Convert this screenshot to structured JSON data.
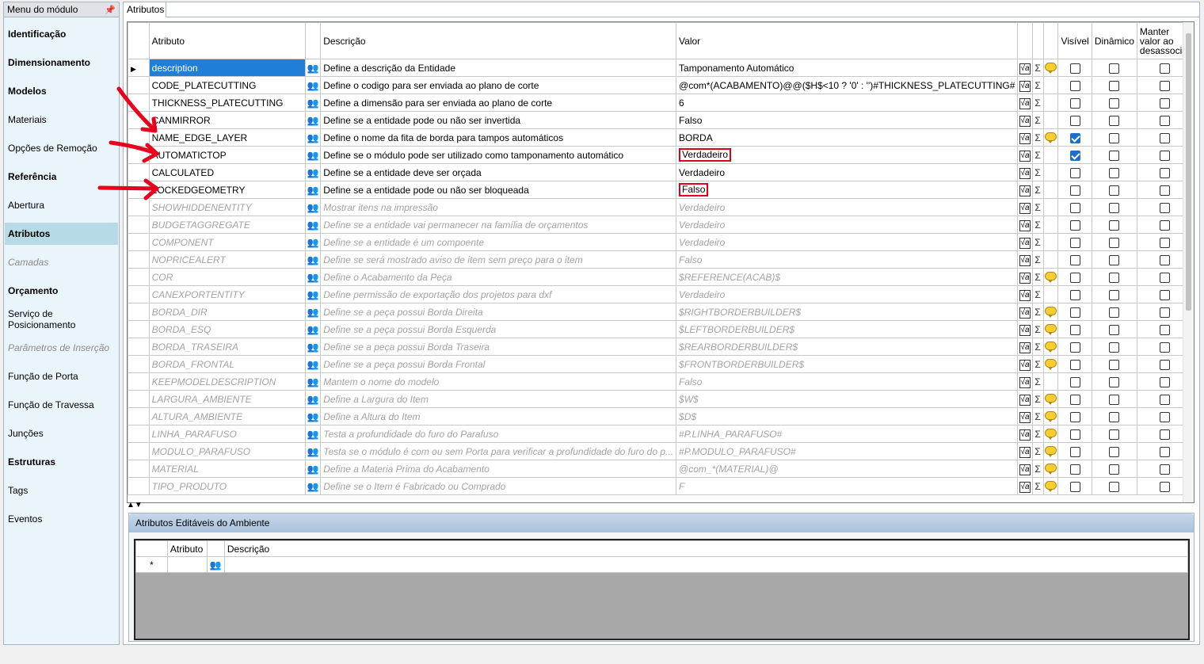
{
  "sidebar": {
    "title": "Menu do módulo",
    "items": [
      {
        "label": "Identificação",
        "style": "bold"
      },
      {
        "label": "Dimensionamento",
        "style": "bold"
      },
      {
        "label": "Modelos",
        "style": "bold"
      },
      {
        "label": "Materiais",
        "style": "normal"
      },
      {
        "label": "Opções de Remoção",
        "style": "normal"
      },
      {
        "label": "Referência",
        "style": "bold"
      },
      {
        "label": "Abertura",
        "style": "normal"
      },
      {
        "label": "Atributos",
        "style": "active"
      },
      {
        "label": "Camadas",
        "style": "disabled"
      },
      {
        "label": "Orçamento",
        "style": "bold"
      },
      {
        "label": "Serviço de Posicionamento",
        "style": "normal"
      },
      {
        "label": "Parâmetros de Inserção",
        "style": "disabled"
      },
      {
        "label": "Função de Porta",
        "style": "normal"
      },
      {
        "label": "Função de Travessa",
        "style": "normal"
      },
      {
        "label": "Junções",
        "style": "normal"
      },
      {
        "label": "Estruturas",
        "style": "bold"
      },
      {
        "label": "Tags",
        "style": "normal"
      },
      {
        "label": "Eventos",
        "style": "normal"
      }
    ]
  },
  "tab": {
    "label": "Atributos"
  },
  "grid": {
    "columns": {
      "attribute": "Atributo",
      "description": "Descrição",
      "value": "Valor",
      "visible": "Visível",
      "dynamic": "Dinâmico",
      "keep": "Manter valor ao desassociar"
    },
    "rows": [
      {
        "attr": "description",
        "desc": "Define a descrição da Entidade",
        "value": "Tamponamento Automático",
        "disabled": false,
        "bubble": true,
        "visible": false,
        "selected": true,
        "highlight": false
      },
      {
        "attr": "CODE_PLATECUTTING",
        "desc": "Define o codigo para ser enviada ao plano de corte",
        "value": "@com*(ACABAMENTO)@@($H$<10 ? '0' : '')#THICKNESS_PLATECUTTING#",
        "disabled": false,
        "bubble": false,
        "visible": false
      },
      {
        "attr": "THICKNESS_PLATECUTTING",
        "desc": "Define a dimensão para ser enviada ao plano de corte",
        "value": "6",
        "disabled": false,
        "bubble": false,
        "visible": false
      },
      {
        "attr": "CANMIRROR",
        "desc": "Define se a entidade pode ou não ser invertida",
        "value": "Falso",
        "disabled": false,
        "bubble": false,
        "visible": false
      },
      {
        "attr": "NAME_EDGE_LAYER",
        "desc": "Define o nome da fita de borda para tampos automáticos",
        "value": "BORDA",
        "disabled": false,
        "bubble": true,
        "visible": true
      },
      {
        "attr": "AUTOMATICTOP",
        "desc": "Define se o módulo pode ser utilizado como tamponamento automático",
        "value": "Verdadeiro",
        "disabled": false,
        "bubble": false,
        "visible": true,
        "highlight": true
      },
      {
        "attr": "CALCULATED",
        "desc": "Define se a entidade deve ser orçada",
        "value": "Verdadeiro",
        "disabled": false,
        "bubble": false,
        "visible": false
      },
      {
        "attr": "LOCKEDGEOMETRY",
        "desc": "Define se a entidade pode ou não ser bloqueada",
        "value": "Falso",
        "disabled": false,
        "bubble": false,
        "visible": false,
        "highlight": true
      },
      {
        "attr": "SHOWHIDDENENTITY",
        "desc": "Mostrar itens na impressão",
        "value": "Verdadeiro",
        "disabled": true,
        "bubble": false,
        "visible": false
      },
      {
        "attr": "BUDGETAGGREGATE",
        "desc": "Define se a entidade vai permanecer na família de orçamentos",
        "value": "Verdadeiro",
        "disabled": true,
        "bubble": false,
        "visible": false
      },
      {
        "attr": "COMPONENT",
        "desc": "Define se a entidade é um compoente",
        "value": "Verdadeiro",
        "disabled": true,
        "bubble": false,
        "visible": false
      },
      {
        "attr": "NOPRICEALERT",
        "desc": "Define se será mostrado aviso de item sem preço para o item",
        "value": "Falso",
        "disabled": true,
        "bubble": false,
        "visible": false
      },
      {
        "attr": "COR",
        "desc": "Define o Acabamento da Peça",
        "value": "$REFERENCE(ACAB)$",
        "disabled": true,
        "bubble": true,
        "visible": false
      },
      {
        "attr": "CANEXPORTENTITY",
        "desc": "Define permissão de exportação dos projetos para dxf",
        "value": "Verdadeiro",
        "disabled": true,
        "bubble": false,
        "visible": false
      },
      {
        "attr": "BORDA_DIR",
        "desc": "Define se a peça possui Borda Direita",
        "value": "$RIGHTBORDERBUILDER$",
        "disabled": true,
        "bubble": true,
        "visible": false
      },
      {
        "attr": "BORDA_ESQ",
        "desc": "Define se a peça possui Borda Esquerda",
        "value": "$LEFTBORDERBUILDER$",
        "disabled": true,
        "bubble": true,
        "visible": false
      },
      {
        "attr": "BORDA_TRASEIRA",
        "desc": "Define se a peça possui Borda Traseira",
        "value": "$REARBORDERBUILDER$",
        "disabled": true,
        "bubble": true,
        "visible": false
      },
      {
        "attr": "BORDA_FRONTAL",
        "desc": "Define se a peça possui Borda Frontal",
        "value": "$FRONTBORDERBUILDER$",
        "disabled": true,
        "bubble": true,
        "visible": false
      },
      {
        "attr": "KEEPMODELDESCRIPTION",
        "desc": "Mantem o nome do modelo",
        "value": "Falso",
        "disabled": true,
        "bubble": false,
        "visible": false
      },
      {
        "attr": "LARGURA_AMBIENTE",
        "desc": "Define a Largura do Item",
        "value": "$W$",
        "disabled": true,
        "bubble": true,
        "visible": false
      },
      {
        "attr": "ALTURA_AMBIENTE",
        "desc": "Define a Altura do Item",
        "value": "$D$",
        "disabled": true,
        "bubble": true,
        "visible": false
      },
      {
        "attr": "LINHA_PARAFUSO",
        "desc": "Testa a profundidade do furo do Parafuso",
        "value": "#P.LINHA_PARAFUSO#",
        "disabled": true,
        "bubble": true,
        "visible": false
      },
      {
        "attr": "MODULO_PARAFUSO",
        "desc": "Testa se o módulo é com ou sem Porta para verificar a profundidade do furo do p...",
        "value": "#P.MODULO_PARAFUSO#",
        "disabled": true,
        "bubble": true,
        "visible": false
      },
      {
        "attr": "MATERIAL",
        "desc": "Define a Materia Prima do Acabamento",
        "value": "@com_*(MATERIAL)@",
        "disabled": true,
        "bubble": true,
        "visible": false
      },
      {
        "attr": "TIPO_PRODUTO",
        "desc": "Define se o Item é Fabricado ou Comprado",
        "value": "F",
        "disabled": true,
        "bubble": true,
        "visible": false
      }
    ]
  },
  "bottom_panel": {
    "title": "Atributos Editáveis do Ambiente",
    "columns": {
      "attribute": "Atributo",
      "description": "Descrição"
    },
    "new_row_marker": "*"
  },
  "colors": {
    "selection": "#1f7fd8",
    "highlight_border": "#e0001a",
    "arrow": "#e8001c",
    "active_menu": "#b6dae6"
  }
}
